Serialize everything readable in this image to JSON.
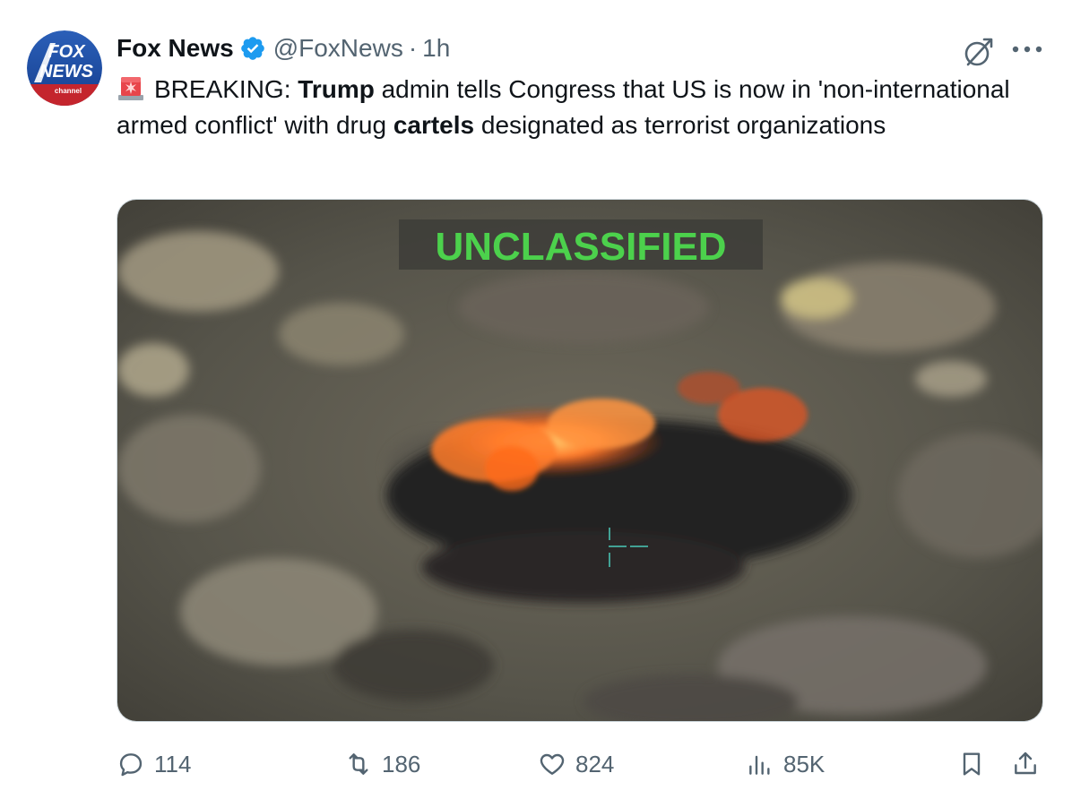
{
  "author": {
    "name": "Fox News",
    "handle": "@FoxNews",
    "separator": "·",
    "time": "1h",
    "avatar_text": {
      "line1": "FOX",
      "line2": "NEWS",
      "line3": "channel"
    }
  },
  "tweet": {
    "segments": [
      {
        "text": "BREAKING: ",
        "bold": false
      },
      {
        "text": "Trump",
        "bold": true
      },
      {
        "text": " admin tells Congress that US is now in 'non-international armed conflict' with drug ",
        "bold": false
      },
      {
        "text": "cartels",
        "bold": true
      },
      {
        "text": " designated as terrorist organizations",
        "bold": false
      }
    ]
  },
  "media": {
    "overlay_label": "UNCLASSIFIED"
  },
  "actions": {
    "replies": "114",
    "reposts": "186",
    "likes": "824",
    "views": "85K"
  },
  "icons": {
    "verified": "verified-badge-icon",
    "grok": "grok-icon",
    "more": "more-icon",
    "siren": "siren-emoji-icon",
    "reply": "reply-icon",
    "repost": "repost-icon",
    "like": "heart-icon",
    "views": "views-chart-icon",
    "bookmark": "bookmark-icon",
    "share": "share-icon"
  },
  "colors": {
    "verified_blue": "#1d9bf0",
    "secondary_text": "#536471",
    "label_green": "#4cd14c",
    "fire_orange": "#ff6a1a"
  }
}
